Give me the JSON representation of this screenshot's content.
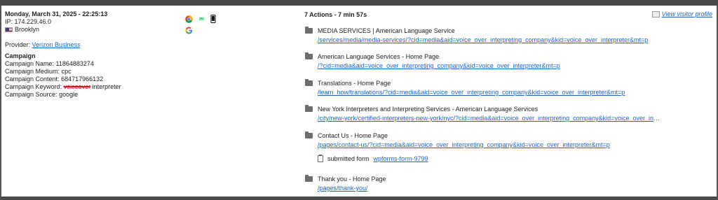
{
  "session": {
    "datetime": "Monday, March 31, 2025 - 22:25:13",
    "ip": "IP: 174.229.46.0",
    "location": "Brooklyn",
    "provider_label": "Provider:",
    "provider": "Verizon Business"
  },
  "campaign": {
    "heading": "Campaign",
    "name_label": "Campaign Name:",
    "name": "11864883274",
    "medium_label": "Campaign Medium:",
    "medium": "cpc",
    "content_label": "Campaign Content:",
    "content": "684717966132",
    "keyword_label": "Campaign Keyword:",
    "keyword_redacted": "voiceover",
    "keyword": "interpreter",
    "source_label": "Campaign Source:",
    "source": "google"
  },
  "device_icons": [
    "chrome-icon",
    "android-icon",
    "mobile-phone-icon",
    "google-icon"
  ],
  "actions_summary": "7 Actions - 7 min 57s",
  "view_profile": "View visitor profile",
  "actions": [
    {
      "title": "MEDIA SERVICES | American Language Service",
      "url": "/services/media/media-services/?cid=media&aid=voice_over_interpreting_company&kid=voice_over_interpreter&mt=p"
    },
    {
      "title": "American Language Services - Home Page",
      "url": "/?cid=media&aid=voice_over_interpreting_company&kid=voice_over_interpreter&mt=p"
    },
    {
      "title": "Translations - Home Page",
      "url": "/learn_how/translations/?cid=media&aid=voice_over_interpreting_company&kid=voice_over_interpreter&mt=p"
    },
    {
      "title": "New York Interpreters and Interpreting Services - American Language Services",
      "url": "/city/new-york/certified-interpreters-new-york/nyc/?cid=media&aid=voice_over_interpreting_company&kid=voice_over_interpreter&mt=p"
    },
    {
      "title": "Contact Us - Home Page",
      "url": "/pages/contact-us/?cid=media&aid=voice_over_interpreting_company&kid=voice_over_interpreter&mt=p",
      "submitted_label": "submitted form",
      "submitted_form": "wpforms-form-9799"
    },
    {
      "title": "Thank you - Home Page",
      "url": "/pages/thank-you/"
    }
  ]
}
